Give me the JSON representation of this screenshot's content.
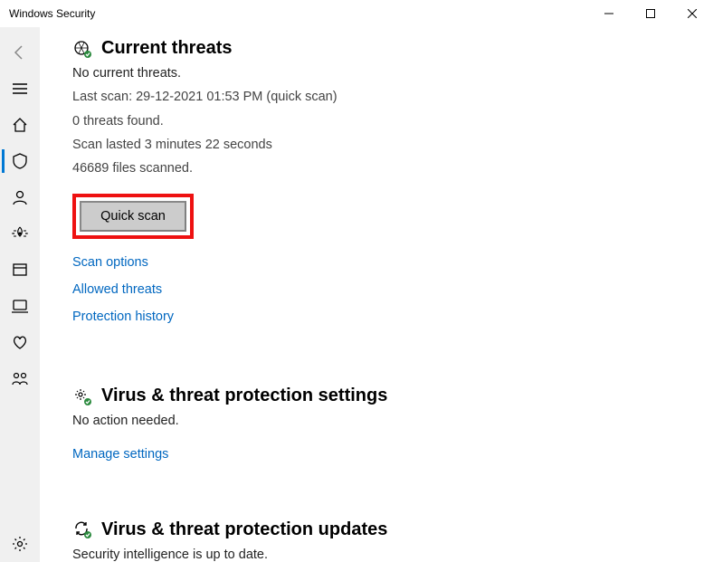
{
  "window": {
    "title": "Windows Security"
  },
  "currentThreats": {
    "heading": "Current threats",
    "status": "No current threats.",
    "lastScan": "Last scan: 29-12-2021 01:53 PM (quick scan)",
    "threatsFound": "0 threats found.",
    "duration": "Scan lasted 3 minutes 22 seconds",
    "filesScanned": "46689 files scanned.",
    "quickScanLabel": "Quick scan",
    "links": {
      "scanOptions": "Scan options",
      "allowedThreats": "Allowed threats",
      "protectionHistory": "Protection history"
    }
  },
  "settings": {
    "heading": "Virus & threat protection settings",
    "status": "No action needed.",
    "manageLink": "Manage settings"
  },
  "updates": {
    "heading": "Virus & threat protection updates",
    "status": "Security intelligence is up to date."
  }
}
